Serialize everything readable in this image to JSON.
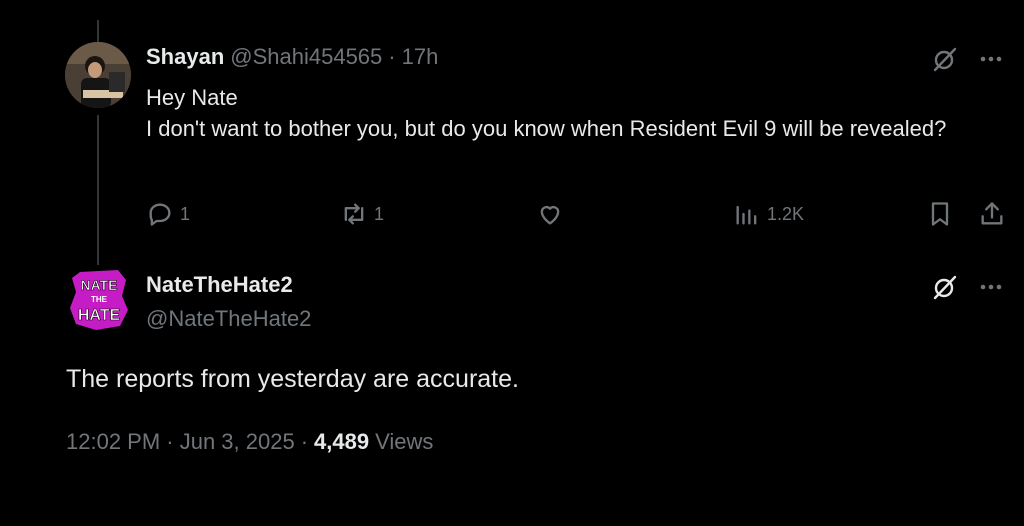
{
  "reply_to": {
    "author_name": "Shayan",
    "author_handle": "@Shahi454565",
    "separator": "·",
    "time_ago": "17h",
    "body_lines": [
      "Hey Nate",
      "I don't want to bother you, but do you know when Resident Evil 9 will be revealed?"
    ],
    "actions": {
      "reply_count": "1",
      "retweet_count": "1",
      "like_count": "",
      "views_count": "1.2K"
    }
  },
  "main_tweet": {
    "author_name": "NateTheHate2",
    "author_handle": "@NateTheHate2",
    "avatar_text": [
      "NATE",
      "THE",
      "HATE"
    ],
    "avatar_color": "#c61cc6",
    "body": "The reports from yesterday are accurate.",
    "timestamp": "12:02 PM · Jun 3, 2025",
    "separator": "·",
    "views_count": "4,489",
    "views_label": "Views"
  },
  "icons": [
    "grok-icon",
    "more-icon",
    "reply-icon",
    "retweet-icon",
    "like-icon",
    "views-icon",
    "bookmark-icon",
    "share-icon"
  ],
  "colors": {
    "background": "#000000",
    "text": "#e7e9ea",
    "muted": "#71767b",
    "thread_line": "#333639"
  }
}
